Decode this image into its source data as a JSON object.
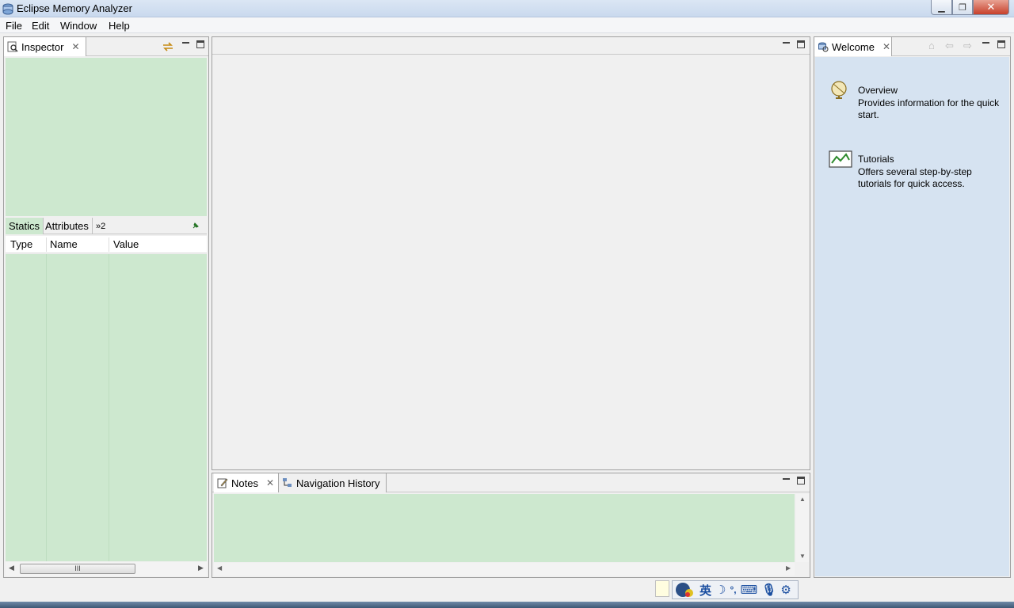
{
  "window": {
    "title": "Eclipse Memory Analyzer"
  },
  "menu": [
    {
      "label": "File"
    },
    {
      "label": "Edit"
    },
    {
      "label": "Window"
    },
    {
      "label": "Help"
    }
  ],
  "inspector": {
    "tab_label": "Inspector",
    "subtabs": [
      "Statics",
      "Attributes"
    ],
    "overflow_label": "»2",
    "columns": [
      "Type",
      "Name",
      "Value"
    ],
    "scroll_thumb": "III"
  },
  "notes_panel": {
    "tabs": [
      "Notes",
      "Navigation History"
    ]
  },
  "welcome": {
    "tab_label": "Welcome",
    "items": [
      {
        "title": "Overview",
        "description": "Provides information for the quick start.",
        "icon": "globe-icon"
      },
      {
        "title": "Tutorials",
        "description": "Offers several step-by-step tutorials for quick access.",
        "icon": "chart-icon"
      }
    ]
  },
  "ime": {
    "label": "英"
  },
  "colors": {
    "accent": "#cde8cf",
    "welcome_bg": "#d6e3f1"
  }
}
